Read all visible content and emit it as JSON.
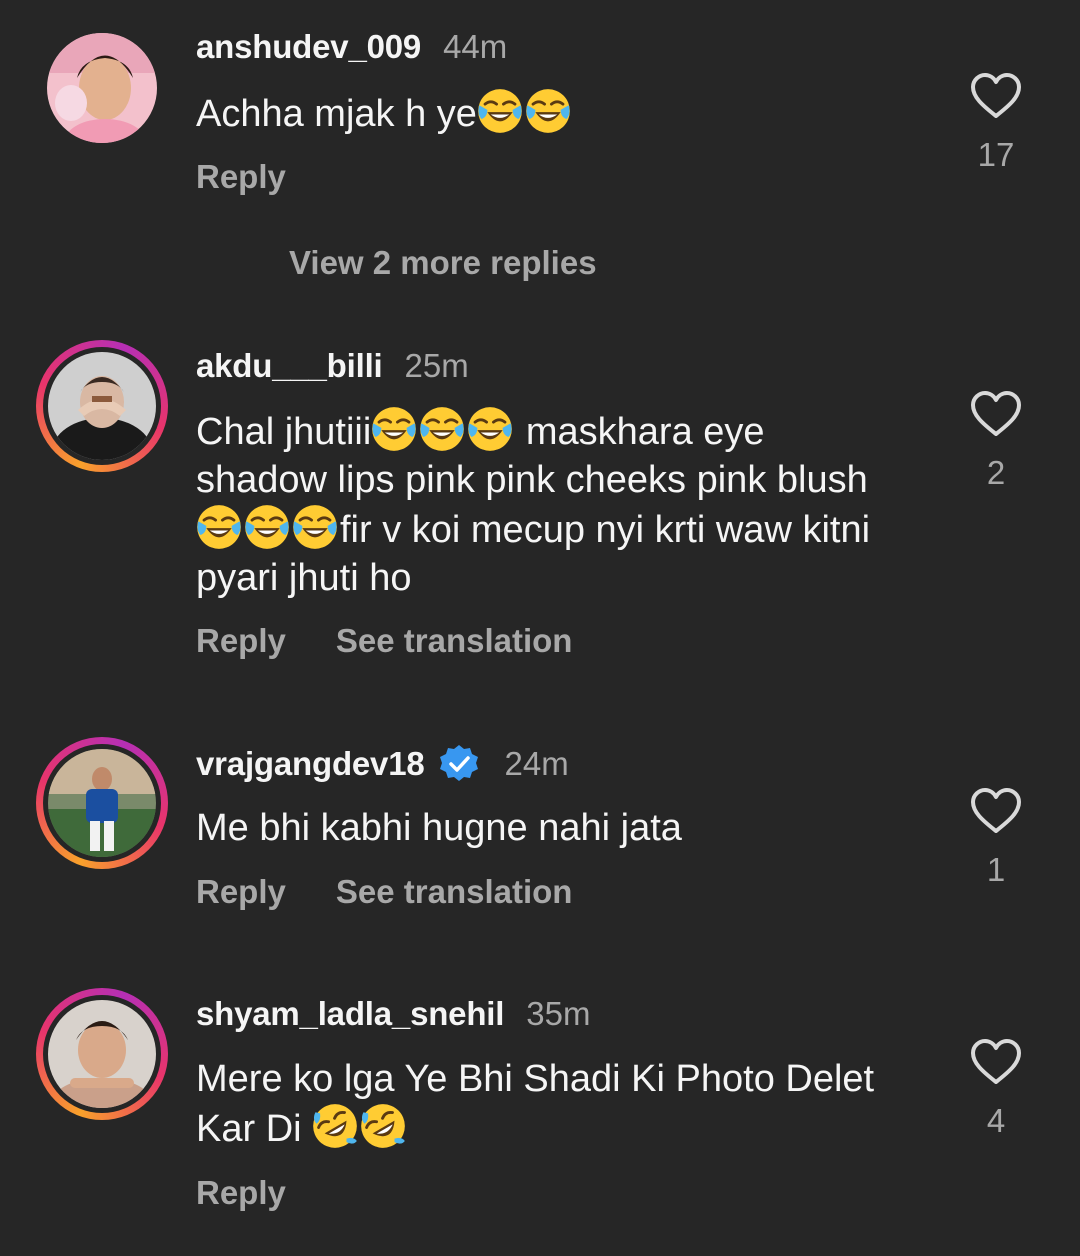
{
  "comments": [
    {
      "username": "anshudev_009",
      "time": "44m",
      "text": "Achha mjak h ye",
      "likes": "17",
      "actions": {
        "reply": "Reply"
      },
      "view_more": "View 2 more replies"
    },
    {
      "username": "akdu___billi",
      "time": "25m",
      "text_parts": [
        "Chal jhutiii",
        " maskhara eye shadow lips pink pink cheeks pink blush ",
        "fir v koi mecup nyi krti waw kitni pyari jhuti ho"
      ],
      "likes": "2",
      "actions": {
        "reply": "Reply",
        "translate": "See translation"
      }
    },
    {
      "username": "vrajgangdev18",
      "time": "24m",
      "verified": true,
      "text": "Me bhi kabhi hugne nahi jata",
      "likes": "1",
      "actions": {
        "reply": "Reply",
        "translate": "See translation"
      }
    },
    {
      "username": "shyam_ladla_snehil",
      "time": "35m",
      "text": "Mere ko lga Ye Bhi Shadi Ki Photo Delet Kar Di",
      "likes": "4",
      "actions": {
        "reply": "Reply"
      }
    }
  ],
  "icons": {
    "like": "heart-outline-icon",
    "verified": "verified-badge-icon",
    "emoji_joy": "face-with-tears-of-joy-emoji",
    "emoji_rofl": "rolling-on-floor-laughing-emoji"
  },
  "colors": {
    "background": "#262626",
    "primary_text": "#f5f5f5",
    "secondary_text": "#a8a8a8",
    "verified_blue": "#3897f0",
    "story_ring_start": "#f9a12b",
    "story_ring_end": "#b62fb5"
  }
}
